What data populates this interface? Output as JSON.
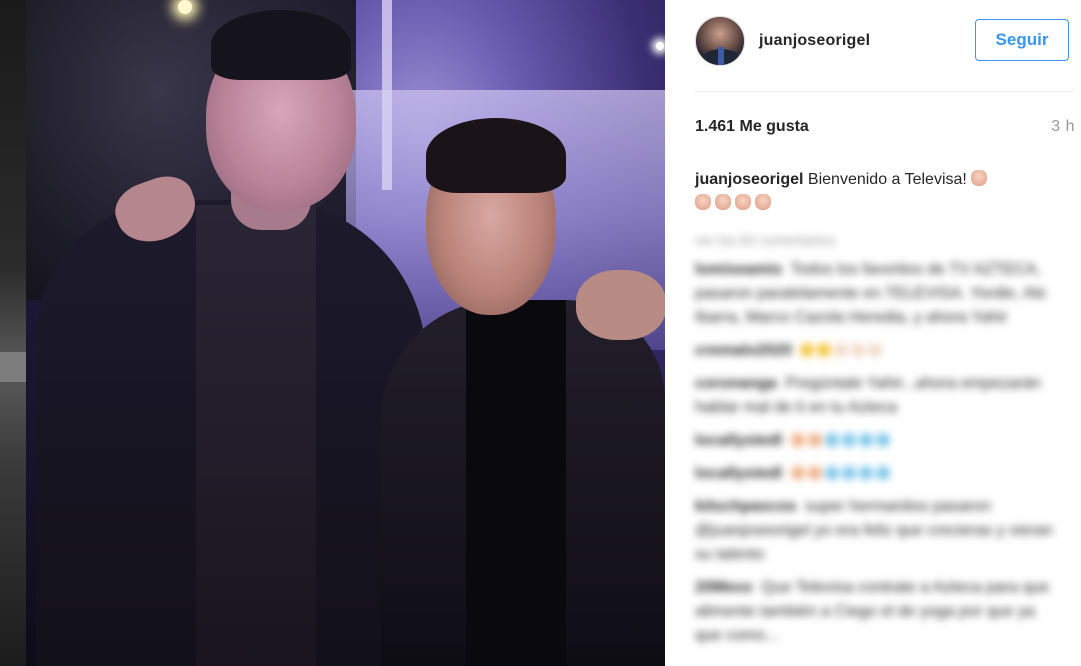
{
  "post": {
    "username": "juanjoseorigel",
    "follow_label": "Seguir",
    "likes_text": "1.461 Me gusta",
    "time_text": "3 h",
    "caption_user": "juanjoseorigel",
    "caption_text": "Bienvenido a Televisa! "
  },
  "comments": {
    "load_more": "ver los 60 comentarios",
    "items": [
      {
        "user": "lomiseamis",
        "text": "Todos los favoritos de TV AZTECA, pasaron paralelamente en TELEVISA. Yordie, Ale Ibarra, Marco Cazola Heredia, y ahora Yahir"
      },
      {
        "user": "cremalo2020",
        "text": ""
      },
      {
        "user": "coronanga",
        "text": "Pregúntale Yahir...ahora empezarán hablar mal de ti en tu Azteca"
      },
      {
        "user": "locallystedl",
        "text": ""
      },
      {
        "user": "locallystedl",
        "text": ""
      },
      {
        "user": "kitschpascos",
        "text": "super hermanitos pasaron @juanjoseorigel yo era feliz que crecieras y vieran su talento"
      },
      {
        "user": "20Mexx",
        "text": "Que Televisa contrate a Azteca para que alimente también a Ciego el de yoga por que ya que como..."
      }
    ]
  },
  "icons": {
    "avatar": "profile-photo",
    "emoji": "waving-hand-emoji"
  },
  "colors": {
    "accent": "#3897f0",
    "text": "#262626",
    "muted": "#999999"
  }
}
